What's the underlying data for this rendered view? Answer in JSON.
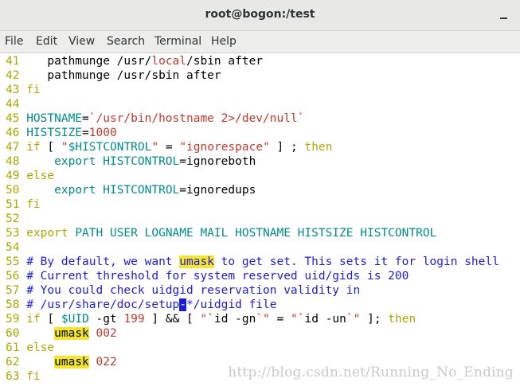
{
  "window": {
    "title": "root@bogon:/test"
  },
  "menu": [
    "File",
    "Edit",
    "View",
    "Search",
    "Terminal",
    "Help"
  ],
  "editor": {
    "lines": [
      {
        "n": "41",
        "t": "    pathmunge /usr/local/sbin after"
      },
      {
        "n": "42",
        "t": "    pathmunge /usr/sbin after"
      },
      {
        "n": "43",
        "t": "fi"
      },
      {
        "n": "44",
        "t": ""
      },
      {
        "n": "45",
        "t": "HOSTNAME=`/usr/bin/hostname 2>/dev/null`"
      },
      {
        "n": "46",
        "t": "HISTSIZE=1000"
      },
      {
        "n": "47",
        "t": "if [ \"$HISTCONTROL\" = \"ignorespace\" ] ; then"
      },
      {
        "n": "48",
        "t": "    export HISTCONTROL=ignoreboth"
      },
      {
        "n": "49",
        "t": "else"
      },
      {
        "n": "50",
        "t": "    export HISTCONTROL=ignoredups"
      },
      {
        "n": "51",
        "t": "fi"
      },
      {
        "n": "52",
        "t": ""
      },
      {
        "n": "53",
        "t": "export PATH USER LOGNAME MAIL HOSTNAME HISTSIZE HISTCONTROL"
      },
      {
        "n": "54",
        "t": ""
      },
      {
        "n": "55",
        "t": "# By default, we want umask to get set. This sets it for login shell"
      },
      {
        "n": "56",
        "t": "# Current threshold for system reserved uid/gids is 200"
      },
      {
        "n": "57",
        "t": "# You could check uidgid reservation validity in"
      },
      {
        "n": "58",
        "t": "# /usr/share/doc/setup-*/uidgid file"
      },
      {
        "n": "59",
        "t": "if [ $UID -gt 199 ] && [ \"`id -gn`\" = \"`id -un`\" ]; then"
      },
      {
        "n": "60",
        "t": "    umask 002"
      },
      {
        "n": "61",
        "t": "else"
      },
      {
        "n": "62",
        "t": "    umask 022"
      },
      {
        "n": "63",
        "t": "fi"
      }
    ]
  },
  "watermark": "http://blog.csdn.net/Running_No_Ending"
}
